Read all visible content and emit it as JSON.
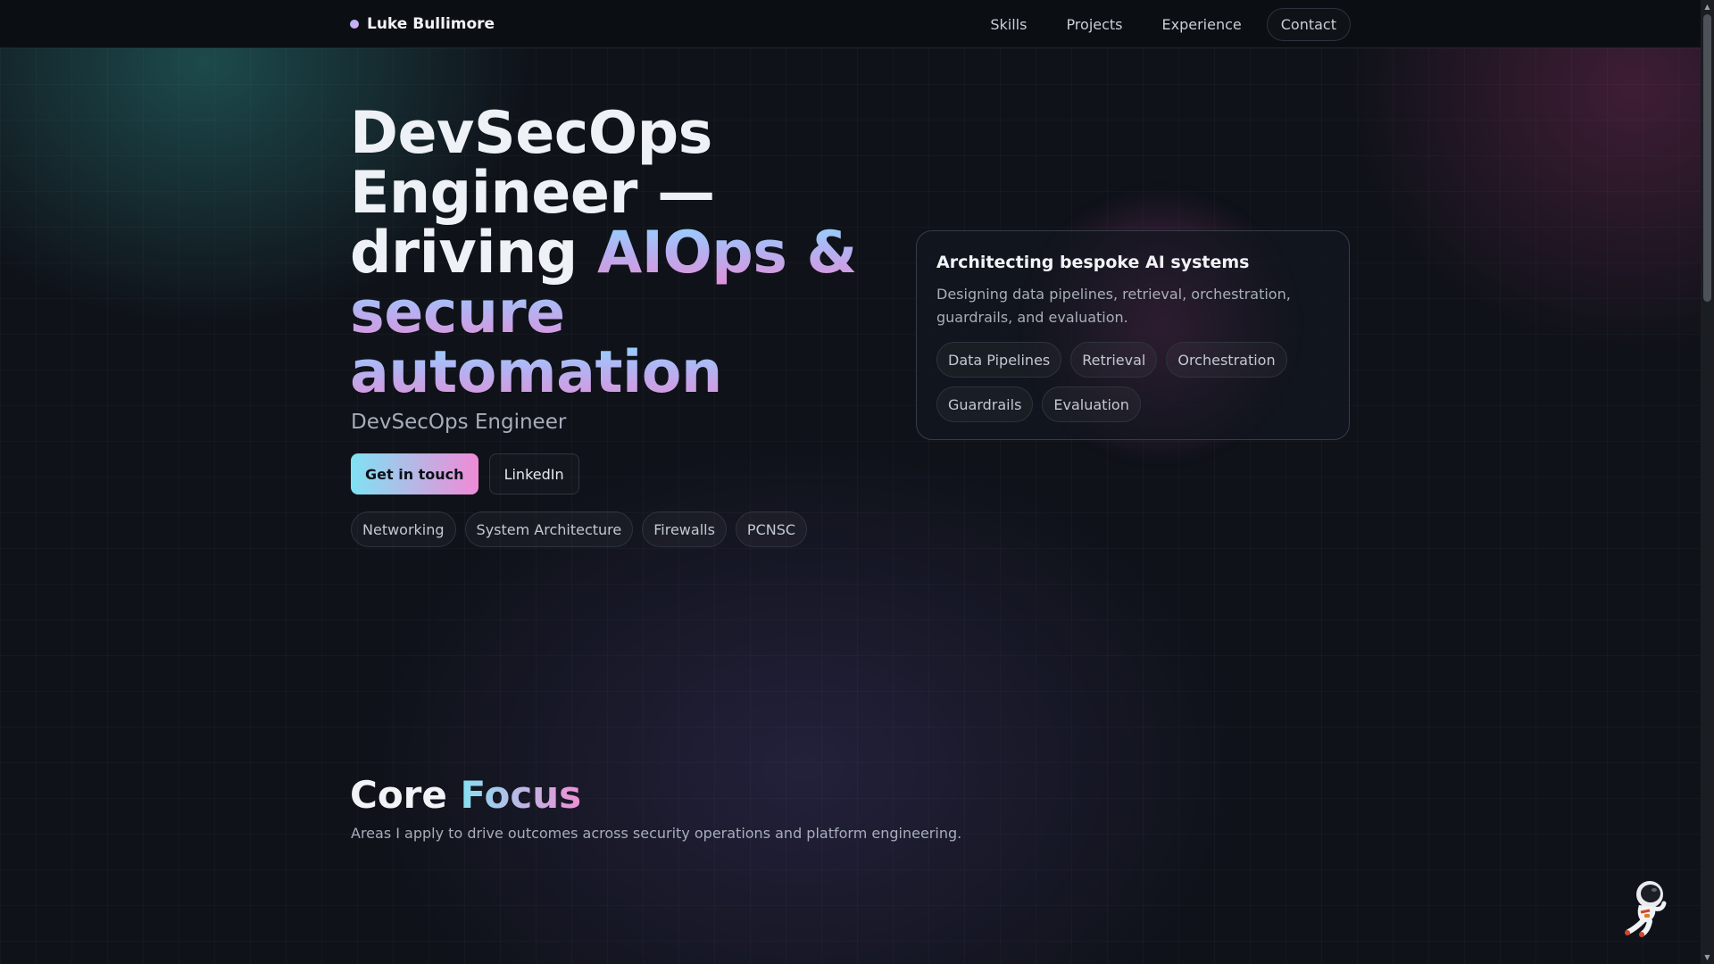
{
  "brand": {
    "name": "Luke Bullimore"
  },
  "nav": {
    "items": [
      "Skills",
      "Projects",
      "Experience",
      "Contact"
    ]
  },
  "hero": {
    "title_line1": "DevSecOps",
    "title_line2": "Engineer —",
    "title_line3_plain": "driving ",
    "title_line3_grad": "AIOps &",
    "title_line4": "secure",
    "title_line5": "automation",
    "subtitle": "DevSecOps Engineer",
    "primary_button": "Get in touch",
    "secondary_button": "LinkedIn",
    "tags": [
      "Networking",
      "System Architecture",
      "Firewalls",
      "PCNSC"
    ]
  },
  "card": {
    "title": "Architecting bespoke AI systems",
    "description": "Designing data pipelines, retrieval, orchestration, guardrails, and evaluation.",
    "tags": [
      "Data Pipelines",
      "Retrieval",
      "Orchestration",
      "Guardrails",
      "Evaluation"
    ]
  },
  "core": {
    "title_plain": "Core ",
    "title_grad": "Focus",
    "subtitle": "Areas I apply to drive outcomes across security operations and platform engineering."
  },
  "icons": {
    "brand": "dot-icon",
    "mascot": "astronaut-icon",
    "scroll_up": "scroll-up-arrow-icon",
    "scroll_down": "scroll-down-arrow-icon"
  },
  "colors": {
    "accent_cyan": "#7fe2f4",
    "accent_pink": "#f08ad6",
    "background": "#0f1219"
  }
}
